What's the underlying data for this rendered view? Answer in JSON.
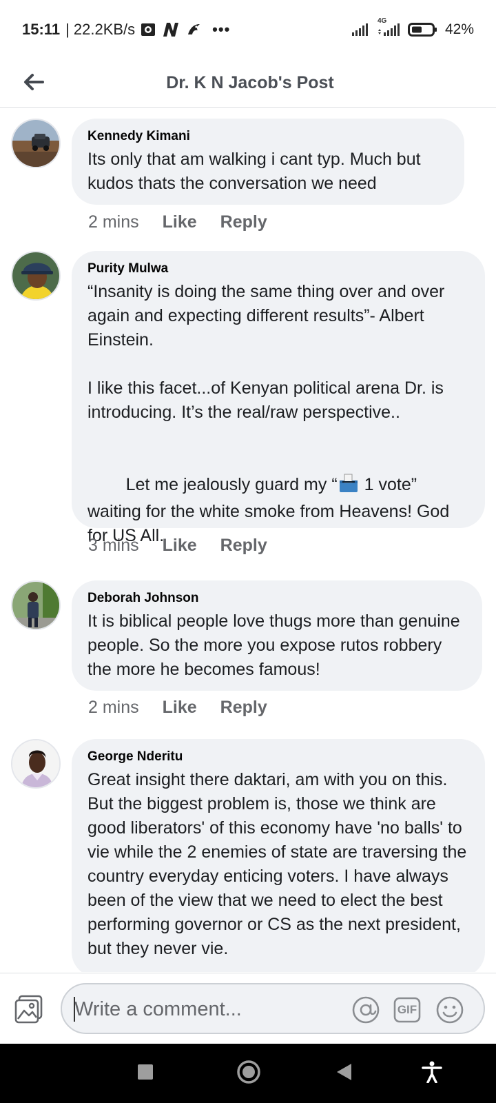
{
  "status_bar": {
    "time": "15:11",
    "speed": "| 22.2KB/s",
    "more": "•••",
    "network": "4G",
    "battery": "42%"
  },
  "header": {
    "title": "Dr. K N Jacob's Post"
  },
  "comments": [
    {
      "author": "Kennedy Kimani",
      "text": "Its only that am walking i cant typ. Much but kudos thats the conversation we need",
      "time": "2 mins",
      "like": "Like",
      "reply": "Reply"
    },
    {
      "author": "Purity Mulwa",
      "text_p1": "“Insanity is doing the same thing over and over again and expecting different results”- Albert Einstein.",
      "text_p2": "I like this facet...of Kenyan political arena Dr. is introducing. It’s the real/raw perspective..",
      "text_p3a": "Let me jealously guard my “",
      "text_p3b": " 1 vote” waiting for the white smoke from Heavens! God for US All.",
      "time": "3 mins",
      "like": "Like",
      "reply": "Reply"
    },
    {
      "author": "Deborah Johnson",
      "text": "It is biblical people love thugs more than genuine people. So the more you expose rutos robbery the more he becomes famous!",
      "time": "2 mins",
      "like": "Like",
      "reply": "Reply"
    },
    {
      "author": "George Nderitu",
      "text": "Great insight there daktari, am with you on this. But the biggest problem is, those we think are good liberators' of this economy have 'no balls' to vie while the 2 enemies of state are traversing the country everyday enticing voters. I have always been of the view that we need to elect the best performing governor or CS as the next president, but they never vie."
    }
  ],
  "composer": {
    "placeholder": "Write a comment...",
    "gif_label": "GIF"
  },
  "icons": {
    "back": "arrow-left-icon",
    "photo": "photo-icon",
    "mention": "at-icon",
    "gif": "gif-icon",
    "emoji": "emoji-icon",
    "ballot": "ballot-box-icon",
    "nav_recents": "square-icon",
    "nav_home": "circle-icon",
    "nav_back": "triangle-icon",
    "accessibility": "accessibility-icon"
  },
  "colors": {
    "bubble": "#f0f2f5",
    "meta_text": "#65676b",
    "nav_bar": "#000000"
  }
}
